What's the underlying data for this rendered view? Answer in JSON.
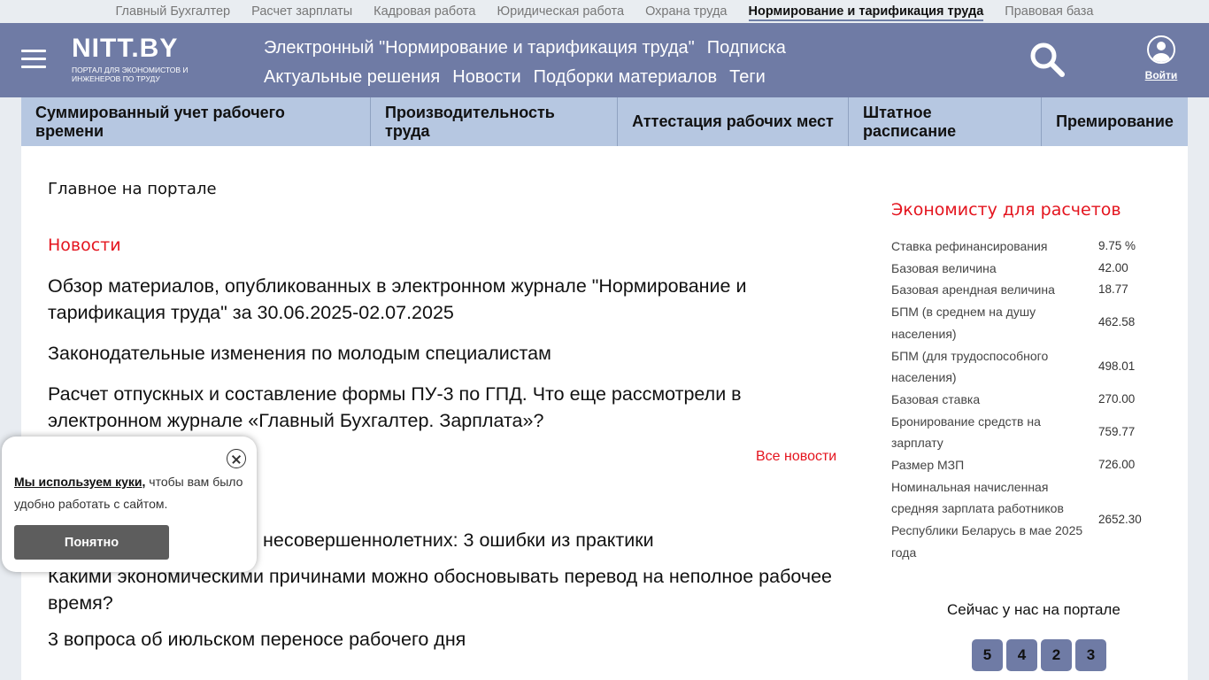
{
  "top_links": [
    "Главный Бухгалтер",
    "Расчет зарплаты",
    "Кадровая работа",
    "Юридическая работа",
    "Охрана труда",
    "Нормирование и тарификация труда",
    "Правовая база"
  ],
  "header": {
    "logo_main": "NITT.BY",
    "logo_sub": "ПОРТАЛ ДЛЯ ЭКОНОМИСТОВ И ИНЖЕНЕРОВ ПО ТРУДУ",
    "nav": [
      "Электронный \"Нормирование и тарификация труда\"",
      "Подписка",
      "Актуальные решения",
      "Новости",
      "Подборки материалов",
      "Теги"
    ],
    "login_label": "Войти"
  },
  "categories": [
    "Суммированный учет рабочего времени",
    "Производительность труда",
    "Аттестация рабочих мест",
    "Штатное расписание",
    "Премирование"
  ],
  "main": {
    "section_title": "Главное на портале",
    "news_heading": "Новости",
    "news": [
      "Обзор материалов, опубликованных в электронном журнале \"Нормирование и тарификация труда\" за 30.06.2025-02.07.2025",
      "Законодательные изменения по молодым специалистам",
      "Расчет отпускных и составление формы ПУ-3 по ГПД. Что еще рассмотрели в электронном журнале «Главный Бухгалтер. Зарплата»?"
    ],
    "all_news": "Все новости",
    "news_2": [
      "несовершеннолетних: 3 ошибки из практики",
      "Какими экономическими причинами можно обосновывать перевод на неполное рабочее время?",
      "3 вопроса об июльском переносе рабочего дня"
    ]
  },
  "sidebar": {
    "eco_title": "Экономисту для расчетов",
    "rows": [
      {
        "label": "Ставка рефинансирования",
        "value": "9.75 %"
      },
      {
        "label": "Базовая величина",
        "value": "42.00"
      },
      {
        "label": "Базовая арендная величина",
        "value": "18.77"
      },
      {
        "label": "БПМ (в среднем на душу населения)",
        "value": "462.58"
      },
      {
        "label": "БПМ (для трудоспособного населения)",
        "value": "498.01"
      },
      {
        "label": "Базовая ставка",
        "value": "270.00"
      },
      {
        "label": "Бронирование средств на зарплату",
        "value": "759.77"
      },
      {
        "label": "Размер МЗП",
        "value": "726.00"
      },
      {
        "label": "Номинальная начисленная средняя зарплата работников Республики Беларусь в мае 2025 года",
        "value": "2652.30"
      }
    ],
    "now_title": "Сейчас у нас на портале",
    "counters": [
      "5",
      "4",
      "2",
      "3"
    ]
  },
  "cookie": {
    "link_text": "Мы используем куки,",
    "text": " чтобы вам было удобно работать с сайтом.",
    "button": "Понятно"
  },
  "colors": {
    "header_bg": "#6f7ba5",
    "categories_bg": "#b6c7e1",
    "accent_red": "#e4141e"
  }
}
